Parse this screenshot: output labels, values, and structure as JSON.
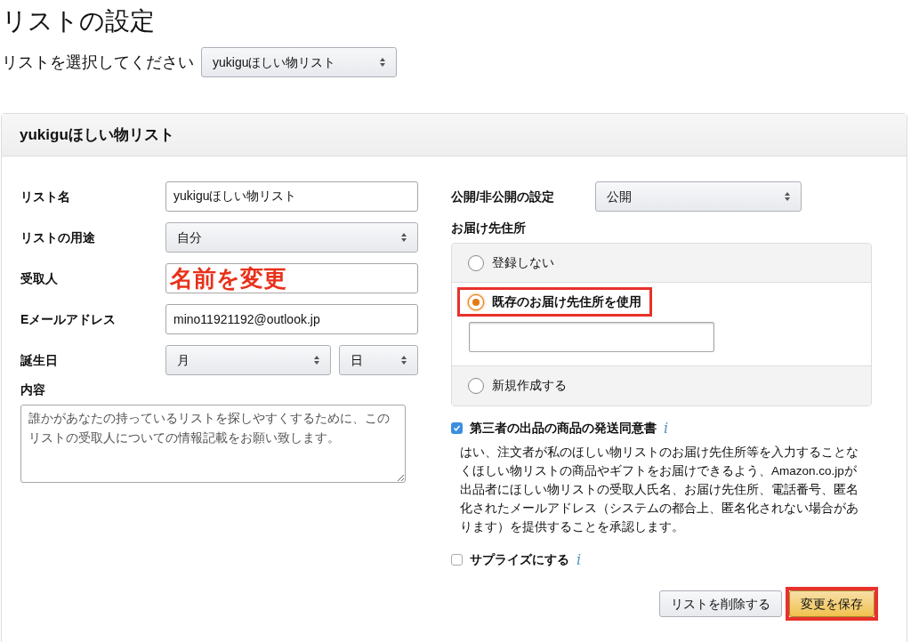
{
  "page_title": "リストの設定",
  "list_selector": {
    "label": "リストを選択してください",
    "value": "yukiguほしい物リスト"
  },
  "panel": {
    "title": "yukiguほしい物リスト",
    "fields": [
      {
        "kind": "text",
        "label": "リスト名",
        "value": "yukiguほしい物リスト"
      },
      {
        "kind": "select",
        "label": "リストの用途",
        "value": "自分"
      },
      {
        "kind": "annotated",
        "label": "受取人",
        "value": "名前を変更"
      },
      {
        "kind": "text",
        "label": "Eメールアドレス",
        "value": "mino11921192@outlook.jp"
      },
      {
        "kind": "date",
        "label": "誕生日",
        "month": "月",
        "day": "日"
      }
    ],
    "description": {
      "label": "内容",
      "value": "誰かがあなたの持っているリストを探しやすくするために、このリストの受取人についての情報記載をお願い致します。"
    },
    "visibility": {
      "label": "公開/非公開の設定",
      "value": "公開"
    },
    "address": {
      "label": "お届け先住所",
      "options": [
        {
          "label": "登録しない",
          "selected": false,
          "highlighted": false
        },
        {
          "label": "既存のお届け先住所を使用",
          "selected": true,
          "highlighted": true
        },
        {
          "label": "新規作成する",
          "selected": false,
          "highlighted": false
        }
      ]
    },
    "consent": {
      "label": "第三者の出品の商品の発送同意書",
      "info": "i",
      "checked": true,
      "text": "はい、注文者が私のほしい物リストのお届け先住所等を入力することなくほしい物リストの商品やギフトをお届けできるよう、Amazon.co.jpが出品者にほしい物リストの受取人氏名、お届け先住所、電話番号、匿名化されたメールアドレス（システムの都合上、匿名化されない場合があります）を提供することを承認します。"
    },
    "surprise": {
      "label": "サプライズにする",
      "info": "i",
      "checked": false
    },
    "buttons": [
      {
        "kind": "secondary",
        "label": "リストを削除する",
        "highlighted": false
      },
      {
        "kind": "primary",
        "label": "変更を保存",
        "highlighted": true
      }
    ]
  }
}
